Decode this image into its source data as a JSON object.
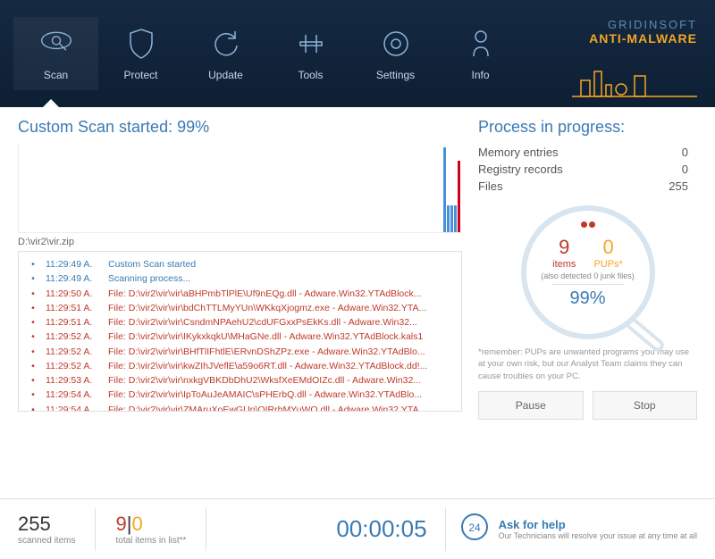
{
  "brand": {
    "line1": "GRIDINSOFT",
    "line2": "ANTI-MALWARE"
  },
  "nav": {
    "scan": "Scan",
    "protect": "Protect",
    "update": "Update",
    "tools": "Tools",
    "settings": "Settings",
    "info": "Info"
  },
  "scan": {
    "title": "Custom Scan started:  99%",
    "filepath": "D:\\vir2\\vir.zip"
  },
  "log": [
    {
      "type": "info",
      "time": "11:29:49 A.",
      "msg": "Custom Scan started"
    },
    {
      "type": "info",
      "time": "11:29:49 A.",
      "msg": "Scanning process..."
    },
    {
      "type": "threat",
      "time": "11:29:50 A.",
      "msg": "File: D:\\vir2\\vir\\vir\\aBHPmbTlPlE\\Uf9nEQg.dll - Adware.Win32.YTAdBlock..."
    },
    {
      "type": "threat",
      "time": "11:29:51 A.",
      "msg": "File: D:\\vir2\\vir\\vir\\bdChTTLMyYUn\\WKkqXjogmz.exe - Adware.Win32.YTA..."
    },
    {
      "type": "threat",
      "time": "11:29:51 A.",
      "msg": "File: D:\\vir2\\vir\\vir\\CsndmNPAehU2\\cdUFGxxPsEkKs.dll - Adware.Win32..."
    },
    {
      "type": "threat",
      "time": "11:29:52 A.",
      "msg": "File: D:\\vir2\\vir\\vir\\IKykxkqkU\\MHaGNe.dll - Adware.Win32.YTAdBlock.kals1"
    },
    {
      "type": "threat",
      "time": "11:29:52 A.",
      "msg": "File: D:\\vir2\\vir\\vir\\BHfTlIFhtlE\\ERvnDShZPz.exe - Adware.Win32.YTAdBlo..."
    },
    {
      "type": "threat",
      "time": "11:29:52 A.",
      "msg": "File: D:\\vir2\\vir\\vir\\kwZIhJVeflE\\a59o6RT.dll - Adware.Win32.YTAdBlock.dd!..."
    },
    {
      "type": "threat",
      "time": "11:29:53 A.",
      "msg": "File: D:\\vir2\\vir\\vir\\nxkgVBKDbDhU2\\WksfXeEMdOIZc.dll - Adware.Win32..."
    },
    {
      "type": "threat",
      "time": "11:29:54 A.",
      "msg": "File: D:\\vir2\\vir\\vir\\IpToAuJeAMAIC\\sPHErbQ.dll - Adware.Win32.YTAdBlo..."
    },
    {
      "type": "threat",
      "time": "11:29:54 A.",
      "msg": "File: D:\\vir2\\vir\\vir\\ZMAruXoEwGUn\\QIRrhMYuWQ.dll - Adware.Win32.YTA..."
    }
  ],
  "process": {
    "title": "Process in progress:",
    "memory_label": "Memory entries",
    "memory_val": "0",
    "registry_label": "Registry records",
    "registry_val": "0",
    "files_label": "Files",
    "files_val": "255"
  },
  "gauge": {
    "items_count": "9",
    "items_label": "items",
    "pups_count": "0",
    "pups_label": "PUPs*",
    "sub": "(also detected 0 junk files)",
    "percent": "99%"
  },
  "disclaimer": "*remember: PUPs are unwanted programs you may use at your own risk, but our Analyst Team claims they can cause troubles on your PC.",
  "actions": {
    "pause": "Pause",
    "stop": "Stop"
  },
  "footer": {
    "scanned": "255",
    "scanned_label": "scanned items",
    "total_red": "9",
    "total_orange": "0",
    "total_label": "total items in list**",
    "timer": "00:00:05",
    "help_title": "Ask for help",
    "help_sub": "Our Technicians will resolve your issue at any time at all"
  }
}
